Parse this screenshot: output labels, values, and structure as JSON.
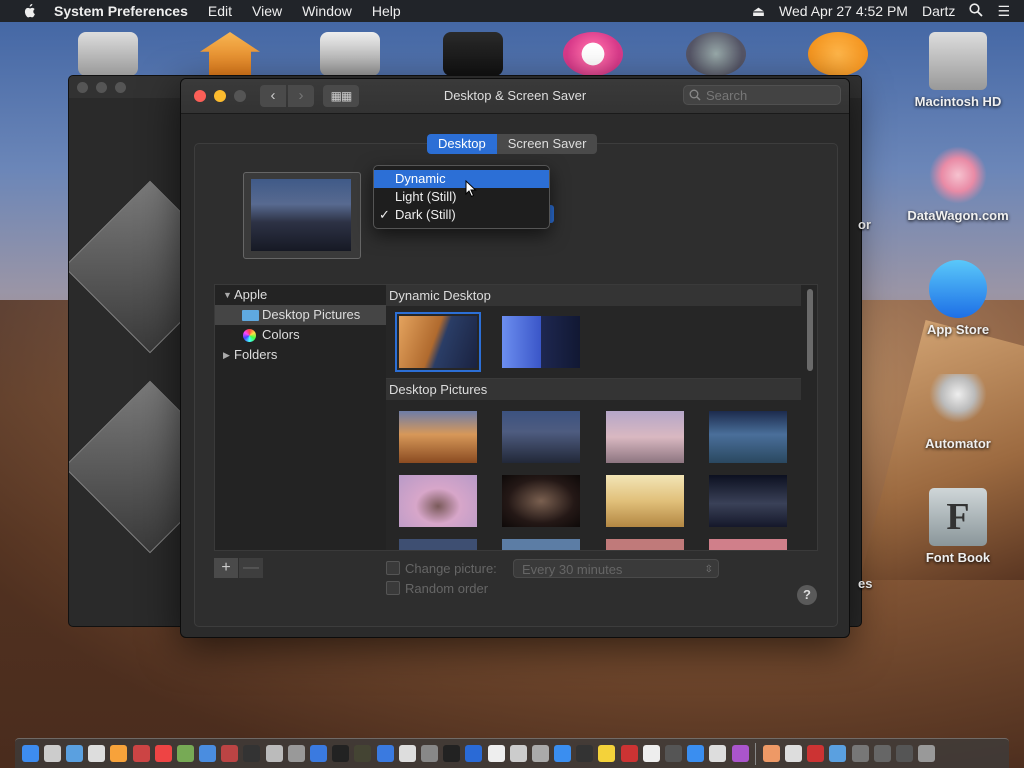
{
  "menubar": {
    "app_name": "System Preferences",
    "menus": [
      "Edit",
      "View",
      "Window",
      "Help"
    ],
    "clock": "Wed Apr 27  4:52 PM",
    "user": "Dartz"
  },
  "window": {
    "title": "Desktop & Screen Saver",
    "search_placeholder": "Search",
    "tabs": [
      {
        "label": "Desktop",
        "selected": true
      },
      {
        "label": "Screen Saver",
        "selected": false
      }
    ]
  },
  "appearance_menu": {
    "options": [
      {
        "label": "Dynamic",
        "highlighted": true,
        "checked": false
      },
      {
        "label": "Light (Still)",
        "highlighted": false,
        "checked": false
      },
      {
        "label": "Dark (Still)",
        "highlighted": false,
        "checked": true
      }
    ],
    "check_mark": "✓"
  },
  "sources": {
    "group_label": "Apple",
    "items": [
      "Desktop Pictures",
      "Colors"
    ],
    "folders_label": "Folders"
  },
  "gallery": {
    "section_dynamic": "Dynamic Desktop",
    "section_pictures": "Desktop Pictures"
  },
  "options": {
    "change_picture_label": "Change picture:",
    "change_interval": "Every 30 minutes",
    "random_order_label": "Random order",
    "add_label": "+",
    "remove_label": "—",
    "help_label": "?"
  },
  "desktop_icons": [
    {
      "label": "Macintosh HD",
      "icon": "hard-drive-icon"
    },
    {
      "label": "DataWagon.com",
      "icon": "datawagon-icon"
    },
    {
      "label": "App Store",
      "icon": "app-store-icon"
    },
    {
      "label": "Automator",
      "icon": "automator-icon"
    },
    {
      "label": "Font Book",
      "icon": "font-book-icon"
    }
  ],
  "colors": {
    "accent": "#2c6fd6",
    "close": "#fc5f57",
    "minimize": "#fdbc2e"
  }
}
